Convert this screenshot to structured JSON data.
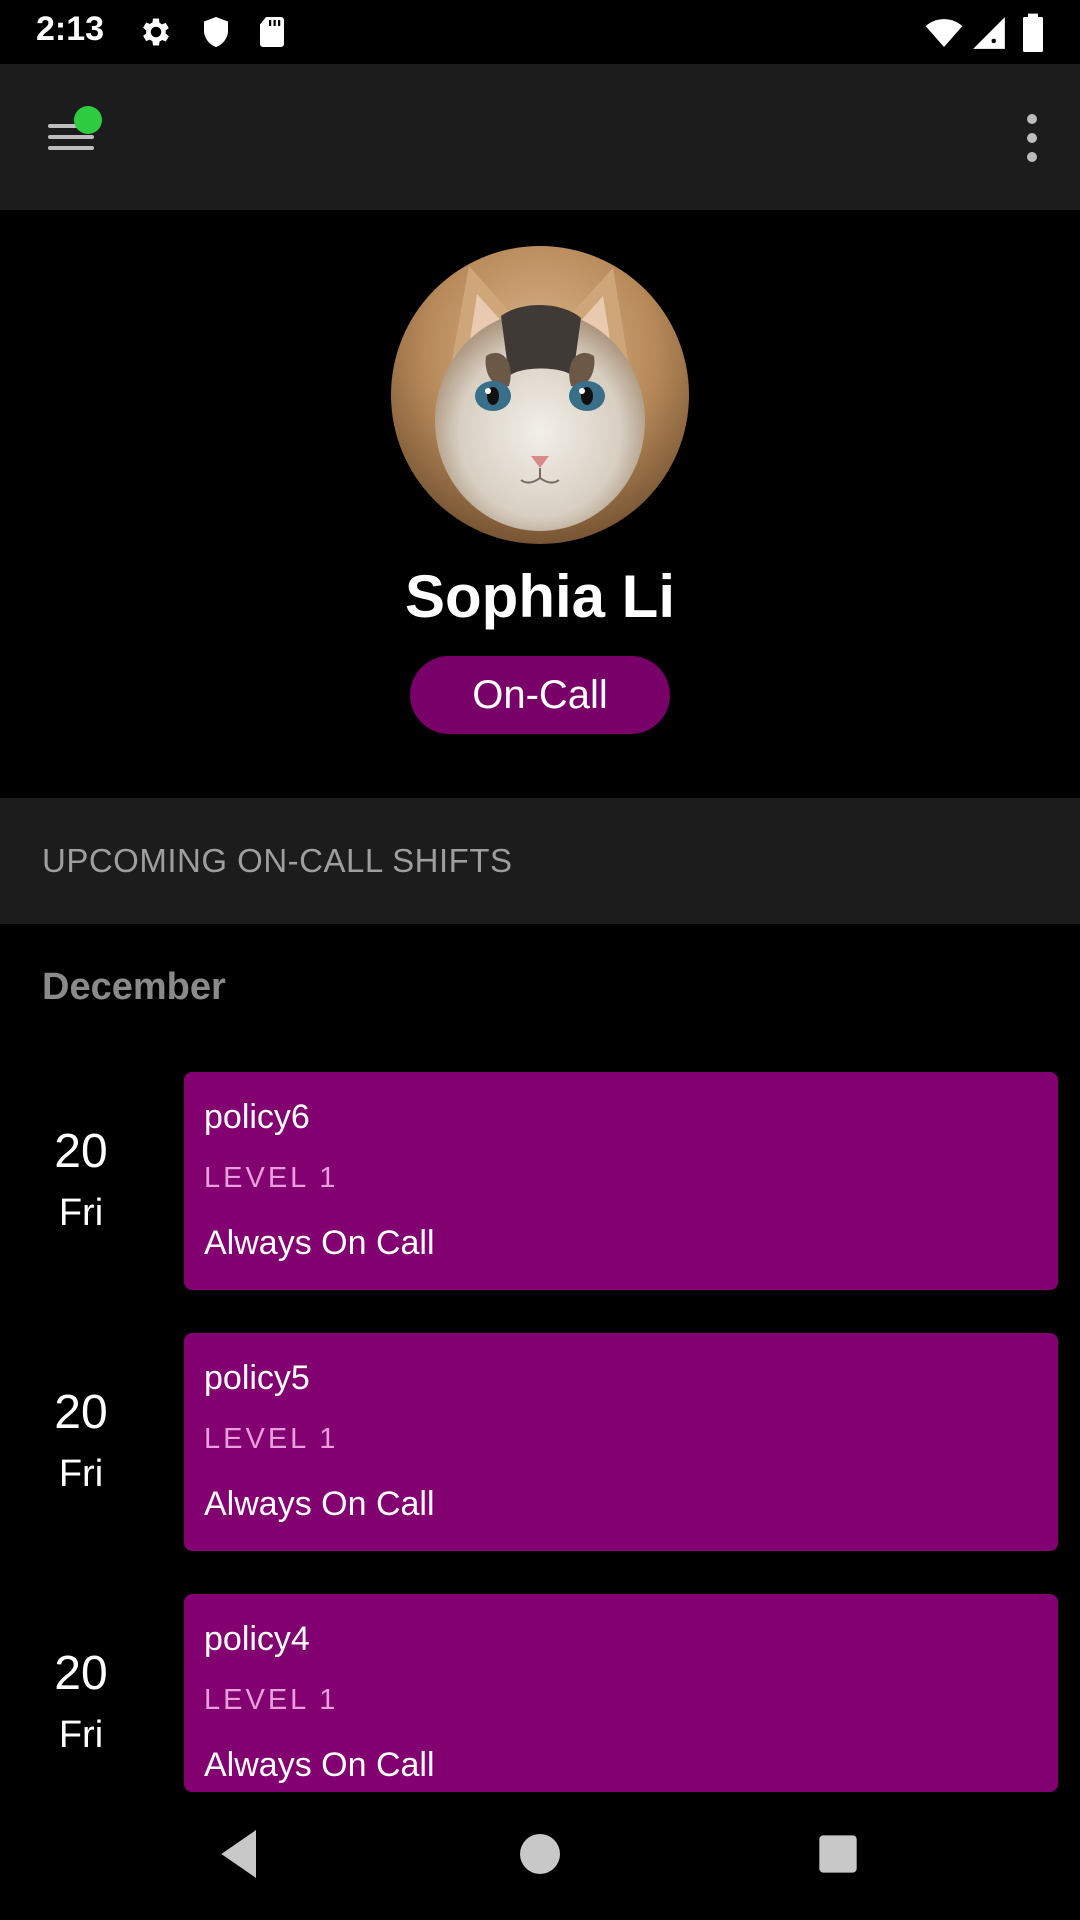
{
  "status_bar": {
    "time": "2:13",
    "left_icons": [
      "gear-icon",
      "shield-icon",
      "sd-card-icon"
    ],
    "right_icons": [
      "wifi-icon",
      "signal-icon",
      "battery-icon"
    ]
  },
  "toolbar": {
    "menu_icon": "hamburger-menu-icon",
    "notification_dot_color": "#2ecc40",
    "overflow_icon": "more-vert-icon"
  },
  "profile": {
    "name": "Sophia Li",
    "status": "On-Call",
    "status_color": "#7a0069"
  },
  "shifts_section": {
    "title": "UPCOMING ON-CALL SHIFTS",
    "month": "December",
    "items": [
      {
        "day": "20",
        "weekday": "Fri",
        "policy": "policy6",
        "level": "LEVEL 1",
        "description": "Always On Call"
      },
      {
        "day": "20",
        "weekday": "Fri",
        "policy": "policy5",
        "level": "LEVEL 1",
        "description": "Always On Call"
      },
      {
        "day": "20",
        "weekday": "Fri",
        "policy": "policy4",
        "level": "LEVEL 1",
        "description": "Always On Call"
      }
    ]
  },
  "nav_bar": {
    "buttons": [
      "back-icon",
      "home-icon",
      "recents-icon"
    ]
  }
}
